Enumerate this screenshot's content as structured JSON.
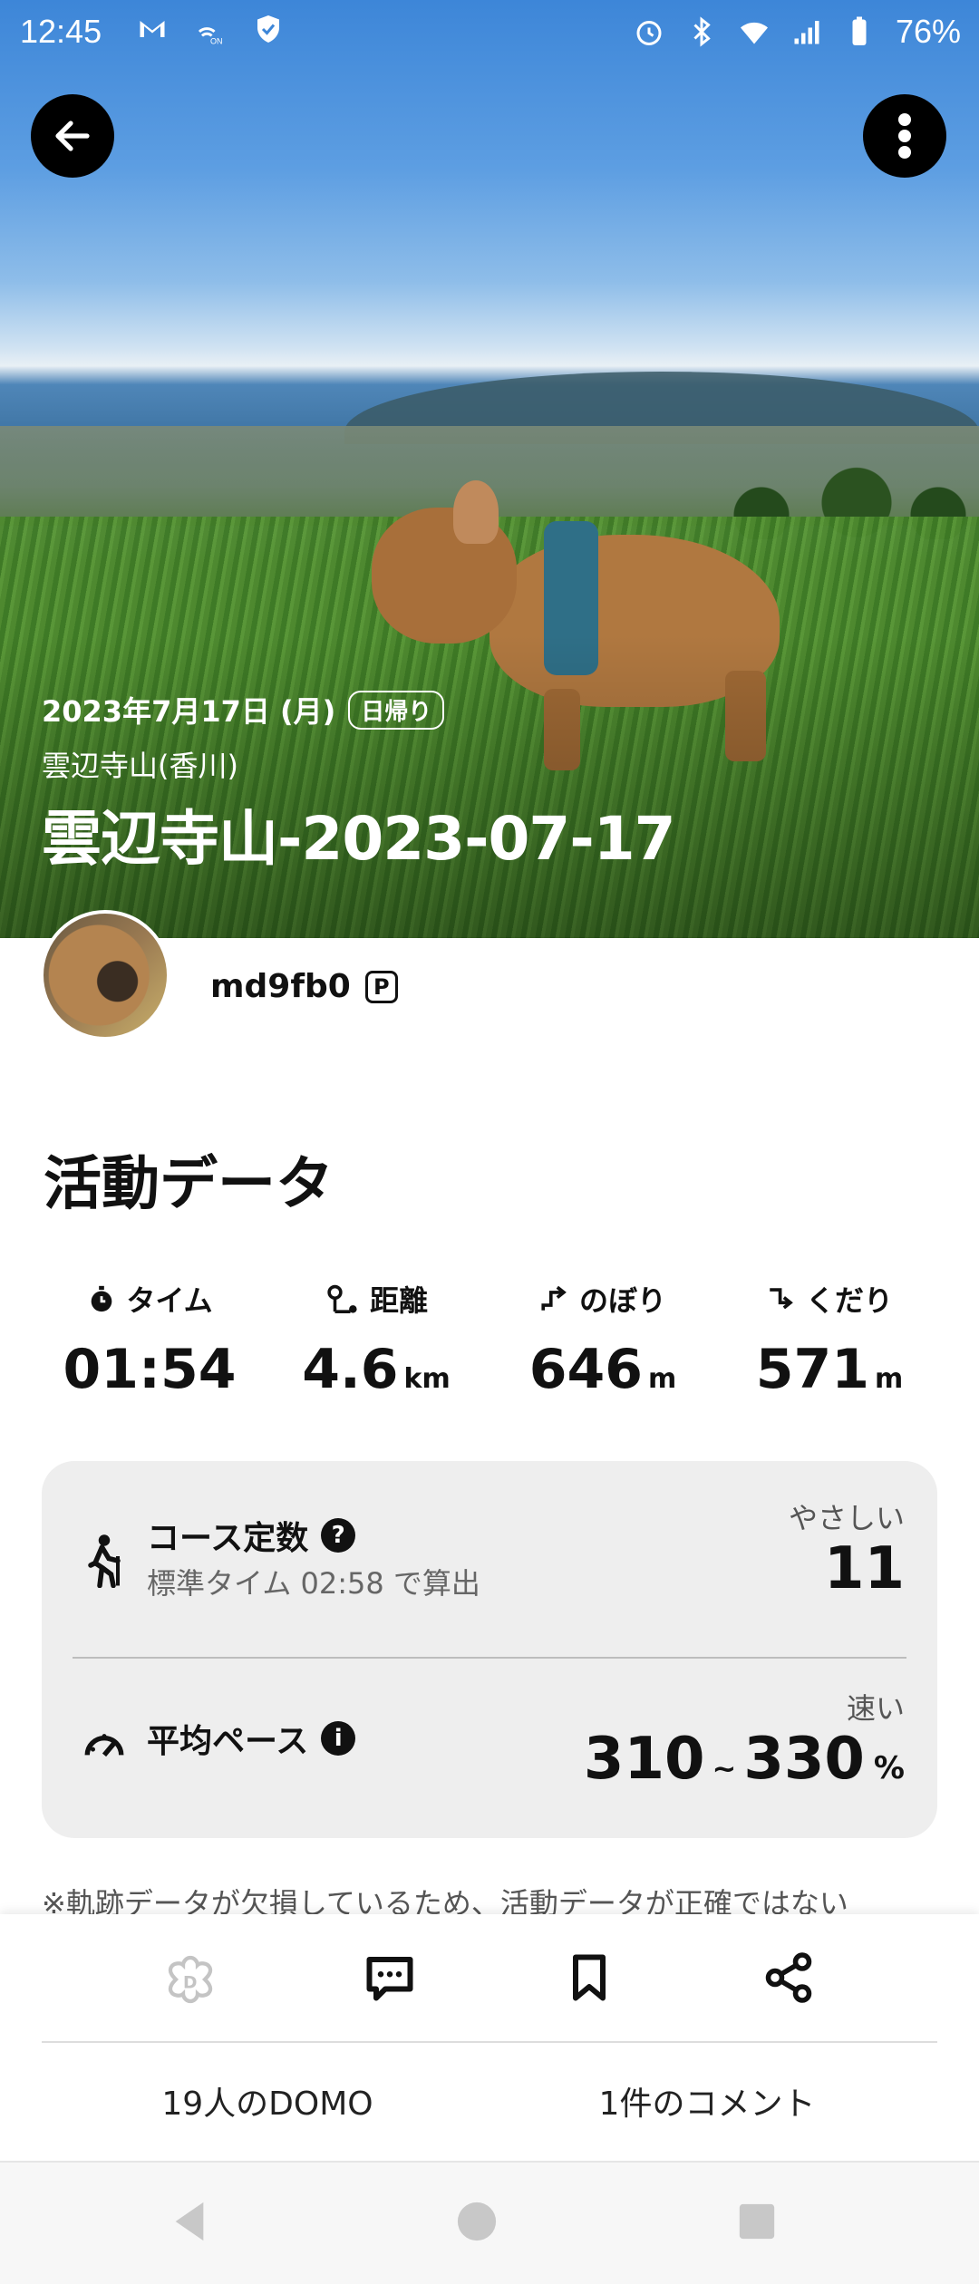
{
  "status_bar": {
    "time": "12:45",
    "battery": "76%"
  },
  "hero": {
    "date": "2023年7月17日 (月)",
    "badge": "日帰り",
    "place": "雲辺寺山(香川)",
    "title": "雲辺寺山-2023-07-17"
  },
  "user": {
    "name": "md9fb0",
    "badge": "P"
  },
  "activity": {
    "title": "活動データ",
    "stats": [
      {
        "label": "タイム",
        "value": "01:54",
        "unit": "",
        "icon": "stopwatch-icon"
      },
      {
        "label": "距離",
        "value": "4.6",
        "unit": "km",
        "icon": "route-icon"
      },
      {
        "label": "のぼり",
        "value": "646",
        "unit": "m",
        "icon": "ascent-icon"
      },
      {
        "label": "くだり",
        "value": "571",
        "unit": "m",
        "icon": "descent-icon"
      }
    ]
  },
  "course": {
    "title": "コース定数",
    "subtitle": "標準タイム 02:58 で算出",
    "level": "やさしい",
    "value": "11"
  },
  "pace": {
    "title": "平均ペース",
    "level": "速い",
    "low": "310",
    "tilde": "~",
    "high": "330",
    "unit": "%"
  },
  "note": "※軌跡データが欠損しているため、活動データが正確ではない",
  "counts": {
    "domo": "19人のDOMO",
    "comments": "1件のコメント"
  }
}
